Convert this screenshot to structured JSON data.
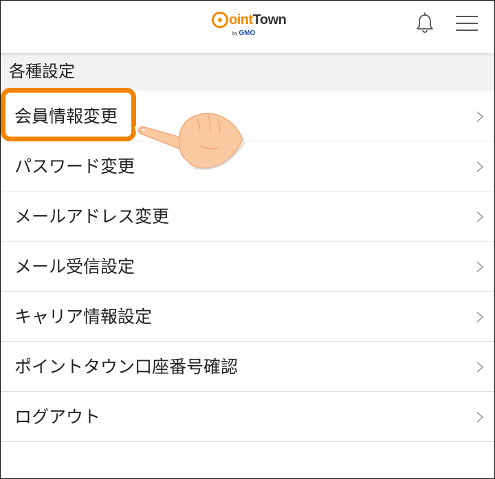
{
  "header": {
    "logo_main_p": "P",
    "logo_main_oint": "oint",
    "logo_main_town": "Town",
    "logo_by": "by",
    "logo_company": "GMO",
    "bell_icon": "bell-icon",
    "menu_icon": "hamburger-menu-icon"
  },
  "section": {
    "title": "各種設定"
  },
  "menu": {
    "items": [
      {
        "label": "会員情報変更"
      },
      {
        "label": "パスワード変更"
      },
      {
        "label": "メールアドレス変更"
      },
      {
        "label": "メール受信設定"
      },
      {
        "label": "キャリア情報設定"
      },
      {
        "label": "ポイントタウン口座番号確認"
      },
      {
        "label": "ログアウト"
      }
    ]
  },
  "annotation": {
    "highlight_color": "#f08300",
    "pointer_icon": "pointing-hand-icon"
  },
  "colors": {
    "brand_orange": "#f08a00",
    "gmo_blue": "#1a4aa8",
    "section_bg": "#f2f2f2"
  }
}
